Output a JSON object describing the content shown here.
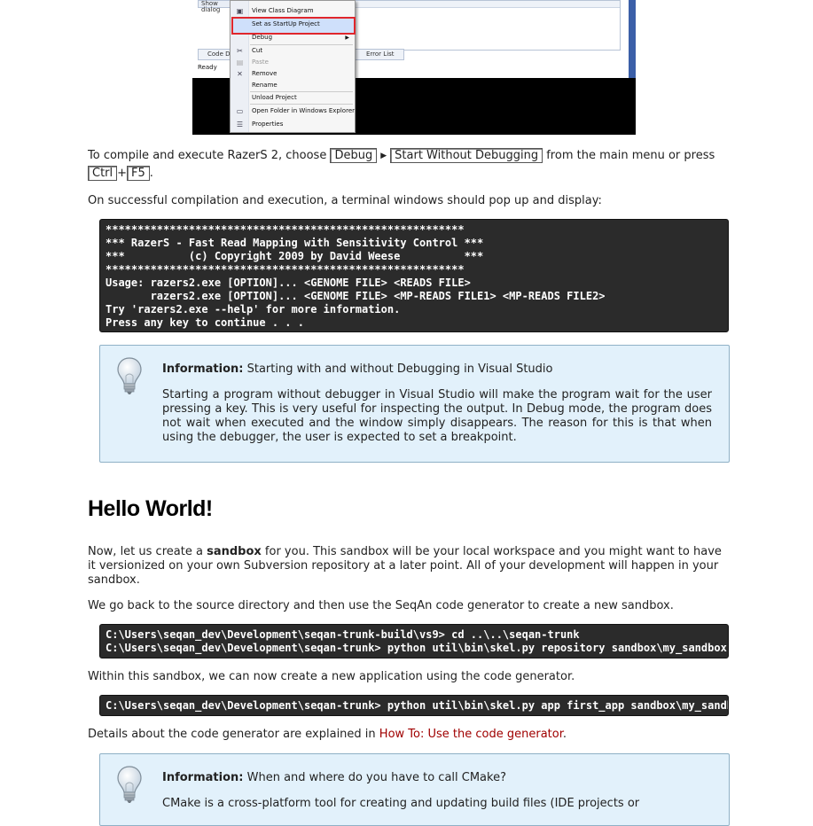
{
  "screenshot": {
    "left_panel_text": "Show dialog",
    "tab_code": "Code De",
    "tab_errors": "Error List",
    "status": "Ready",
    "context_menu": [
      {
        "label": "View Class Diagram",
        "icon": "class-diagram-icon"
      },
      {
        "label": "Set as StartUp Project",
        "icon": "",
        "highlighted": true
      },
      {
        "label": "Debug",
        "icon": "",
        "submenu": true
      },
      {
        "label": "Cut",
        "icon": "scissors-icon"
      },
      {
        "label": "Paste",
        "icon": "paste-icon",
        "disabled": true
      },
      {
        "label": "Remove",
        "icon": "x-icon"
      },
      {
        "label": "Rename",
        "icon": ""
      },
      {
        "label": "Unload Project",
        "icon": ""
      },
      {
        "label": "Open Folder in Windows Explorer",
        "icon": "folder-icon"
      },
      {
        "label": "Properties",
        "icon": "properties-icon"
      }
    ]
  },
  "compile_text": {
    "before": "To compile and execute RazerS 2, choose",
    "menu1": "Debug",
    "menu2": "Start Without Debugging",
    "after": "from the main menu or press",
    "key1": "Ctrl",
    "plus": "+",
    "key2": "F5",
    "end": "."
  },
  "success_text": "On successful compilation and execution, a terminal windows should pop up and display:",
  "terminal1": [
    "********************************************************",
    "*** RazerS - Fast Read Mapping with Sensitivity Control ***",
    "***          (c) Copyright 2009 by David Weese          ***",
    "********************************************************",
    "Usage: razers2.exe [OPTION]... <GENOME FILE> <READS FILE>",
    "       razers2.exe [OPTION]... <GENOME FILE> <MP-READS FILE1> <MP-READS FILE2>",
    "Try 'razers2.exe --help' for more information.",
    "Press any key to continue . . ."
  ],
  "info1": {
    "label": "Information:",
    "title": "Starting with and without Debugging in Visual Studio",
    "body": "Starting a program without debugger in Visual Studio will make the program wait for the user pressing a key. This is very useful for inspecting the output. In Debug mode, the program does not wait when executed and the window simply disappears. The reason for this is that when using the debugger, the user is expected to set a breakpoint."
  },
  "heading": "Hello World!",
  "sandbox_text": {
    "before": "Now, let us create a",
    "bold": "sandbox",
    "after": "for you. This sandbox will be your local workspace and you might want to have it versionized on your own Subversion repository at a later point. All of your development will happen in your sandbox."
  },
  "goback_text": "We go back to the source directory and then use the SeqAn code generator to create a new sandbox.",
  "terminal2": [
    "C:\\Users\\seqan_dev\\Development\\seqan-trunk-build\\vs9> cd ..\\..\\seqan-trunk",
    "C:\\Users\\seqan_dev\\Development\\seqan-trunk> python util\\bin\\skel.py repository sandbox\\my_sandbox"
  ],
  "within_text": "Within this sandbox, we can now create a new application using the code generator.",
  "terminal3": [
    "C:\\Users\\seqan_dev\\Development\\seqan-trunk> python util\\bin\\skel.py app first_app sandbox\\my_sandbox"
  ],
  "details_text": {
    "before": "Details about the code generator are explained in",
    "link": "How To: Use the code generator",
    "after": "."
  },
  "info2": {
    "label": "Information:",
    "title": "When and where do you have to call CMake?",
    "body": "CMake is a cross-platform tool for creating and updating build files (IDE projects or"
  }
}
